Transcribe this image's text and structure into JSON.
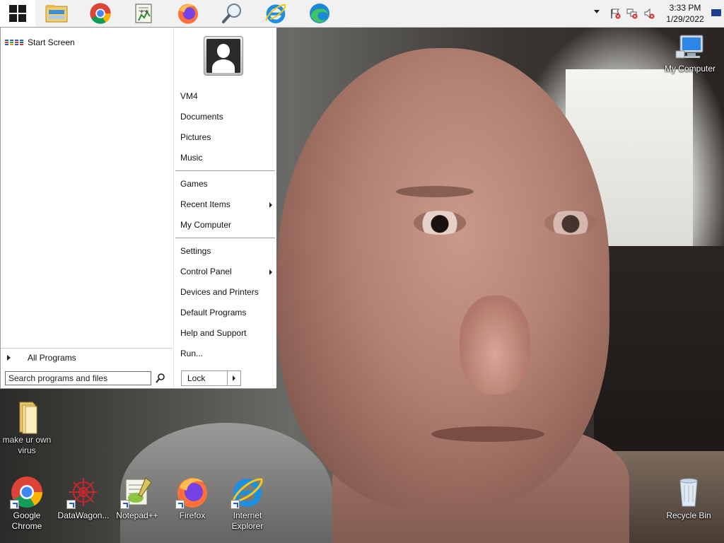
{
  "taskbar": {
    "start_button_label": "Start",
    "pinned": [
      {
        "name": "File Explorer",
        "icon": "folder-icon"
      },
      {
        "name": "Google Chrome",
        "icon": "chrome-icon"
      },
      {
        "name": "Notepad++",
        "icon": "notepad-plus-plus-icon"
      },
      {
        "name": "Firefox",
        "icon": "firefox-icon"
      },
      {
        "name": "Search",
        "icon": "magnifier-icon"
      },
      {
        "name": "Internet Explorer",
        "icon": "internet-explorer-icon"
      },
      {
        "name": "Microsoft Edge",
        "icon": "edge-icon"
      }
    ],
    "tray": {
      "icons": [
        "action-center-flag-icon",
        "network-icon",
        "volume-muted-icon"
      ],
      "time": "3:33 PM",
      "date": "1/29/2022"
    }
  },
  "start_menu": {
    "left": {
      "start_screen_label": "Start Screen",
      "all_programs_label": "All Programs",
      "search_placeholder": "Search programs and files"
    },
    "right": {
      "user_name": "VM4",
      "items": [
        {
          "label": "Documents"
        },
        {
          "label": "Pictures"
        },
        {
          "label": "Music"
        },
        {
          "label": "Games"
        },
        {
          "label": "Recent Items",
          "submenu": true
        },
        {
          "label": "My Computer"
        },
        {
          "label": "Settings"
        },
        {
          "label": "Control Panel",
          "submenu": true
        },
        {
          "label": "Devices and Printers"
        },
        {
          "label": "Default Programs"
        },
        {
          "label": "Help and Support"
        },
        {
          "label": "Run..."
        }
      ],
      "lock_label": "Lock"
    }
  },
  "desktop": {
    "icons": [
      {
        "label": "My Computer",
        "icon": "computer-monitor-icon"
      },
      {
        "label": "make ur own virus",
        "icon": "folder-icon"
      },
      {
        "label": "Google Chrome",
        "icon": "chrome-icon",
        "shortcut": true
      },
      {
        "label": "DataWagon...",
        "icon": "datawagon-icon",
        "shortcut": true
      },
      {
        "label": "Notepad++",
        "icon": "notepad-plus-plus-icon",
        "shortcut": true
      },
      {
        "label": "Firefox",
        "icon": "firefox-icon",
        "shortcut": true
      },
      {
        "label": "Internet Explorer",
        "icon": "internet-explorer-icon",
        "shortcut": true
      },
      {
        "label": "Recycle Bin",
        "icon": "recycle-bin-icon"
      }
    ]
  },
  "colors": {
    "taskbar": "#f1f1f1",
    "start_menu_bg": "#ffffff",
    "edge_blue": "#1e88d4",
    "chrome_red": "#db4437",
    "chrome_green": "#0f9d58",
    "chrome_yellow": "#f4b400",
    "firefox_orange": "#ff7139"
  }
}
